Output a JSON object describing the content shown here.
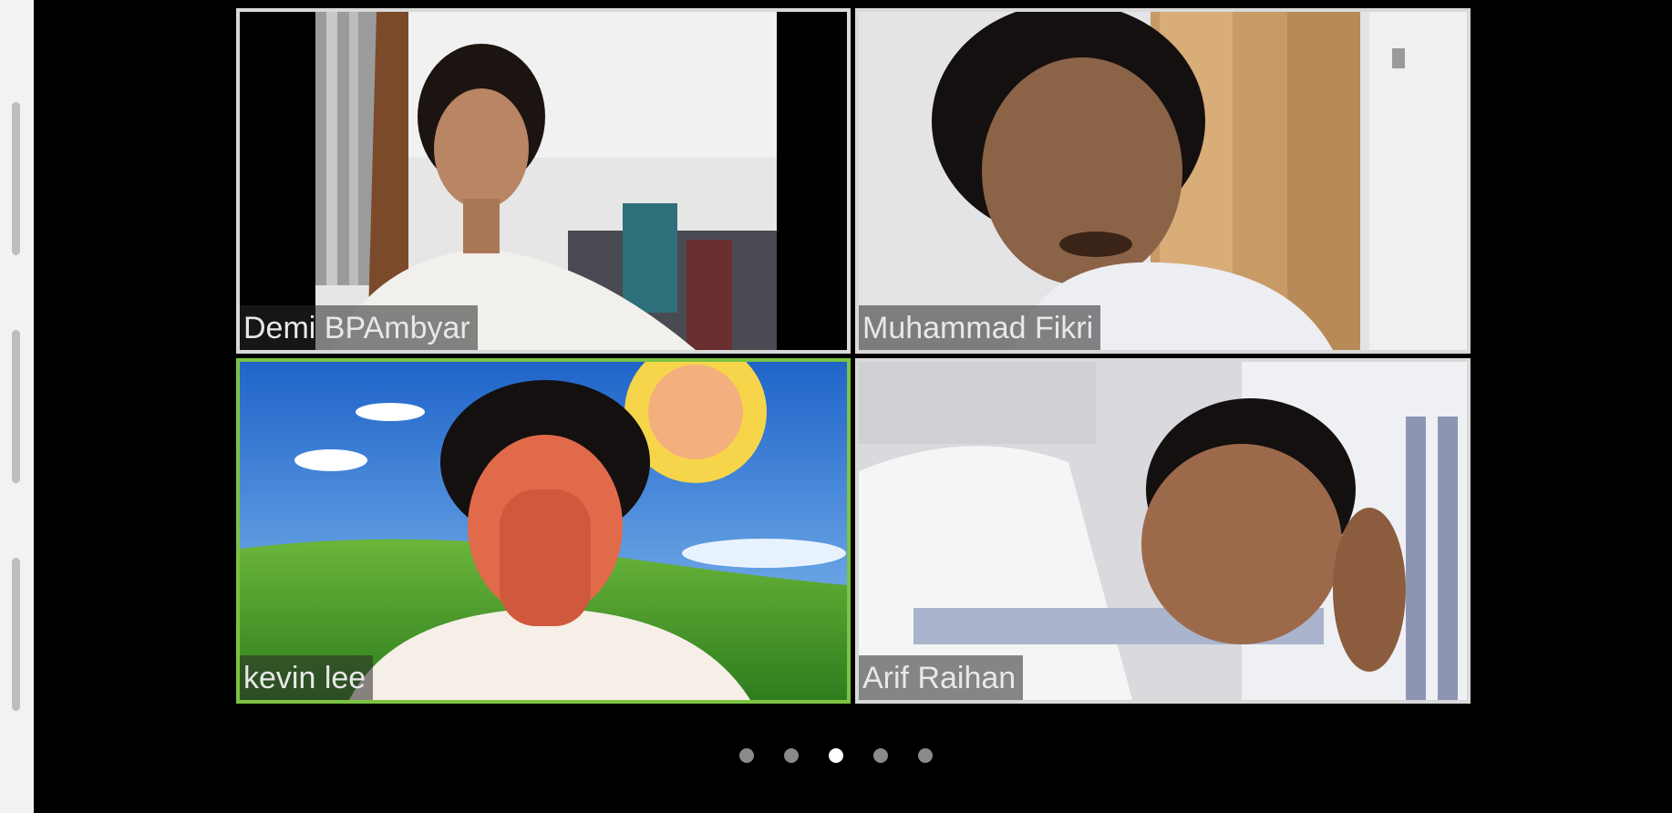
{
  "participants": [
    {
      "name": "Demi BPAmbyar",
      "active": false
    },
    {
      "name": "Muhammad Fikri",
      "active": false
    },
    {
      "name": "kevin lee",
      "active": true
    },
    {
      "name": "Arif Raihan",
      "active": false
    }
  ],
  "pagination": {
    "total": 5,
    "current": 3
  },
  "colors": {
    "active_border": "#7cc243",
    "tile_border": "#d9d9d9",
    "background": "#000000"
  }
}
